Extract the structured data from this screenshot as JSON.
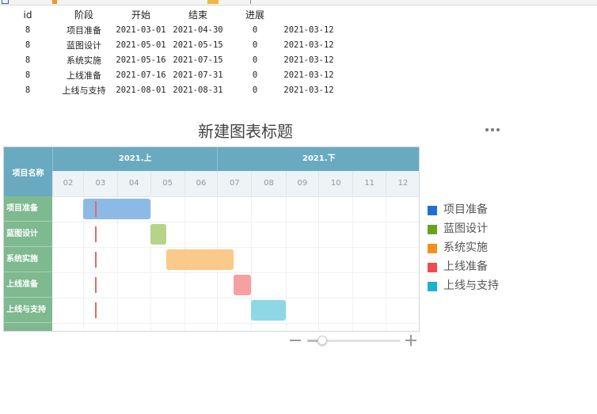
{
  "table": {
    "headers": [
      "id",
      "阶段",
      "开始",
      "结束",
      "进展",
      ""
    ],
    "rows": [
      [
        "8",
        "项目准备",
        "2021-03-01",
        "2021-04-30",
        "0",
        "2021-03-12"
      ],
      [
        "8",
        "蓝图设计",
        "2021-05-01",
        "2021-05-15",
        "0",
        "2021-03-12"
      ],
      [
        "8",
        "系统实施",
        "2021-05-16",
        "2021-07-15",
        "0",
        "2021-03-12"
      ],
      [
        "8",
        "上线准备",
        "2021-07-16",
        "2021-07-31",
        "0",
        "2021-03-12"
      ],
      [
        "8",
        "上线与支持",
        "2021-08-01",
        "2021-08-31",
        "0",
        "2021-03-12"
      ]
    ]
  },
  "chart": {
    "title": "新建图表标题",
    "more_menu_icon": "more-horizontal-icon"
  },
  "chart_data": {
    "type": "gantt",
    "title": "新建图表标题",
    "category_header": "项目名称",
    "timeline_groups": [
      "2021.上",
      "2021.下"
    ],
    "months": [
      "02",
      "03",
      "04",
      "05",
      "06",
      "07",
      "08",
      "09",
      "10",
      "11",
      "12"
    ],
    "axis_start": "2021-02-01",
    "axis_end": "2021-12-31",
    "today": "2021-03-12",
    "tasks": [
      {
        "name": "项目准备",
        "start": "2021-03-01",
        "end": "2021-04-30",
        "color": "#8db9e6"
      },
      {
        "name": "蓝图设计",
        "start": "2021-05-01",
        "end": "2021-05-15",
        "color": "#b5d48a"
      },
      {
        "name": "系统实施",
        "start": "2021-05-16",
        "end": "2021-07-15",
        "color": "#fbc98a"
      },
      {
        "name": "上线准备",
        "start": "2021-07-16",
        "end": "2021-07-31",
        "color": "#f6a0a2"
      },
      {
        "name": "上线与支持",
        "start": "2021-08-01",
        "end": "2021-08-31",
        "color": "#8ed8e6"
      }
    ],
    "legend": [
      {
        "label": "项目准备",
        "color": "#1f6fd1"
      },
      {
        "label": "蓝图设计",
        "color": "#6aa21e"
      },
      {
        "label": "系统实施",
        "color": "#f4901e"
      },
      {
        "label": "上线准备",
        "color": "#f04a4f"
      },
      {
        "label": "上线与支持",
        "color": "#1cb1cf"
      }
    ],
    "legend_position": "right"
  },
  "zoom": {
    "level": 0.12
  }
}
